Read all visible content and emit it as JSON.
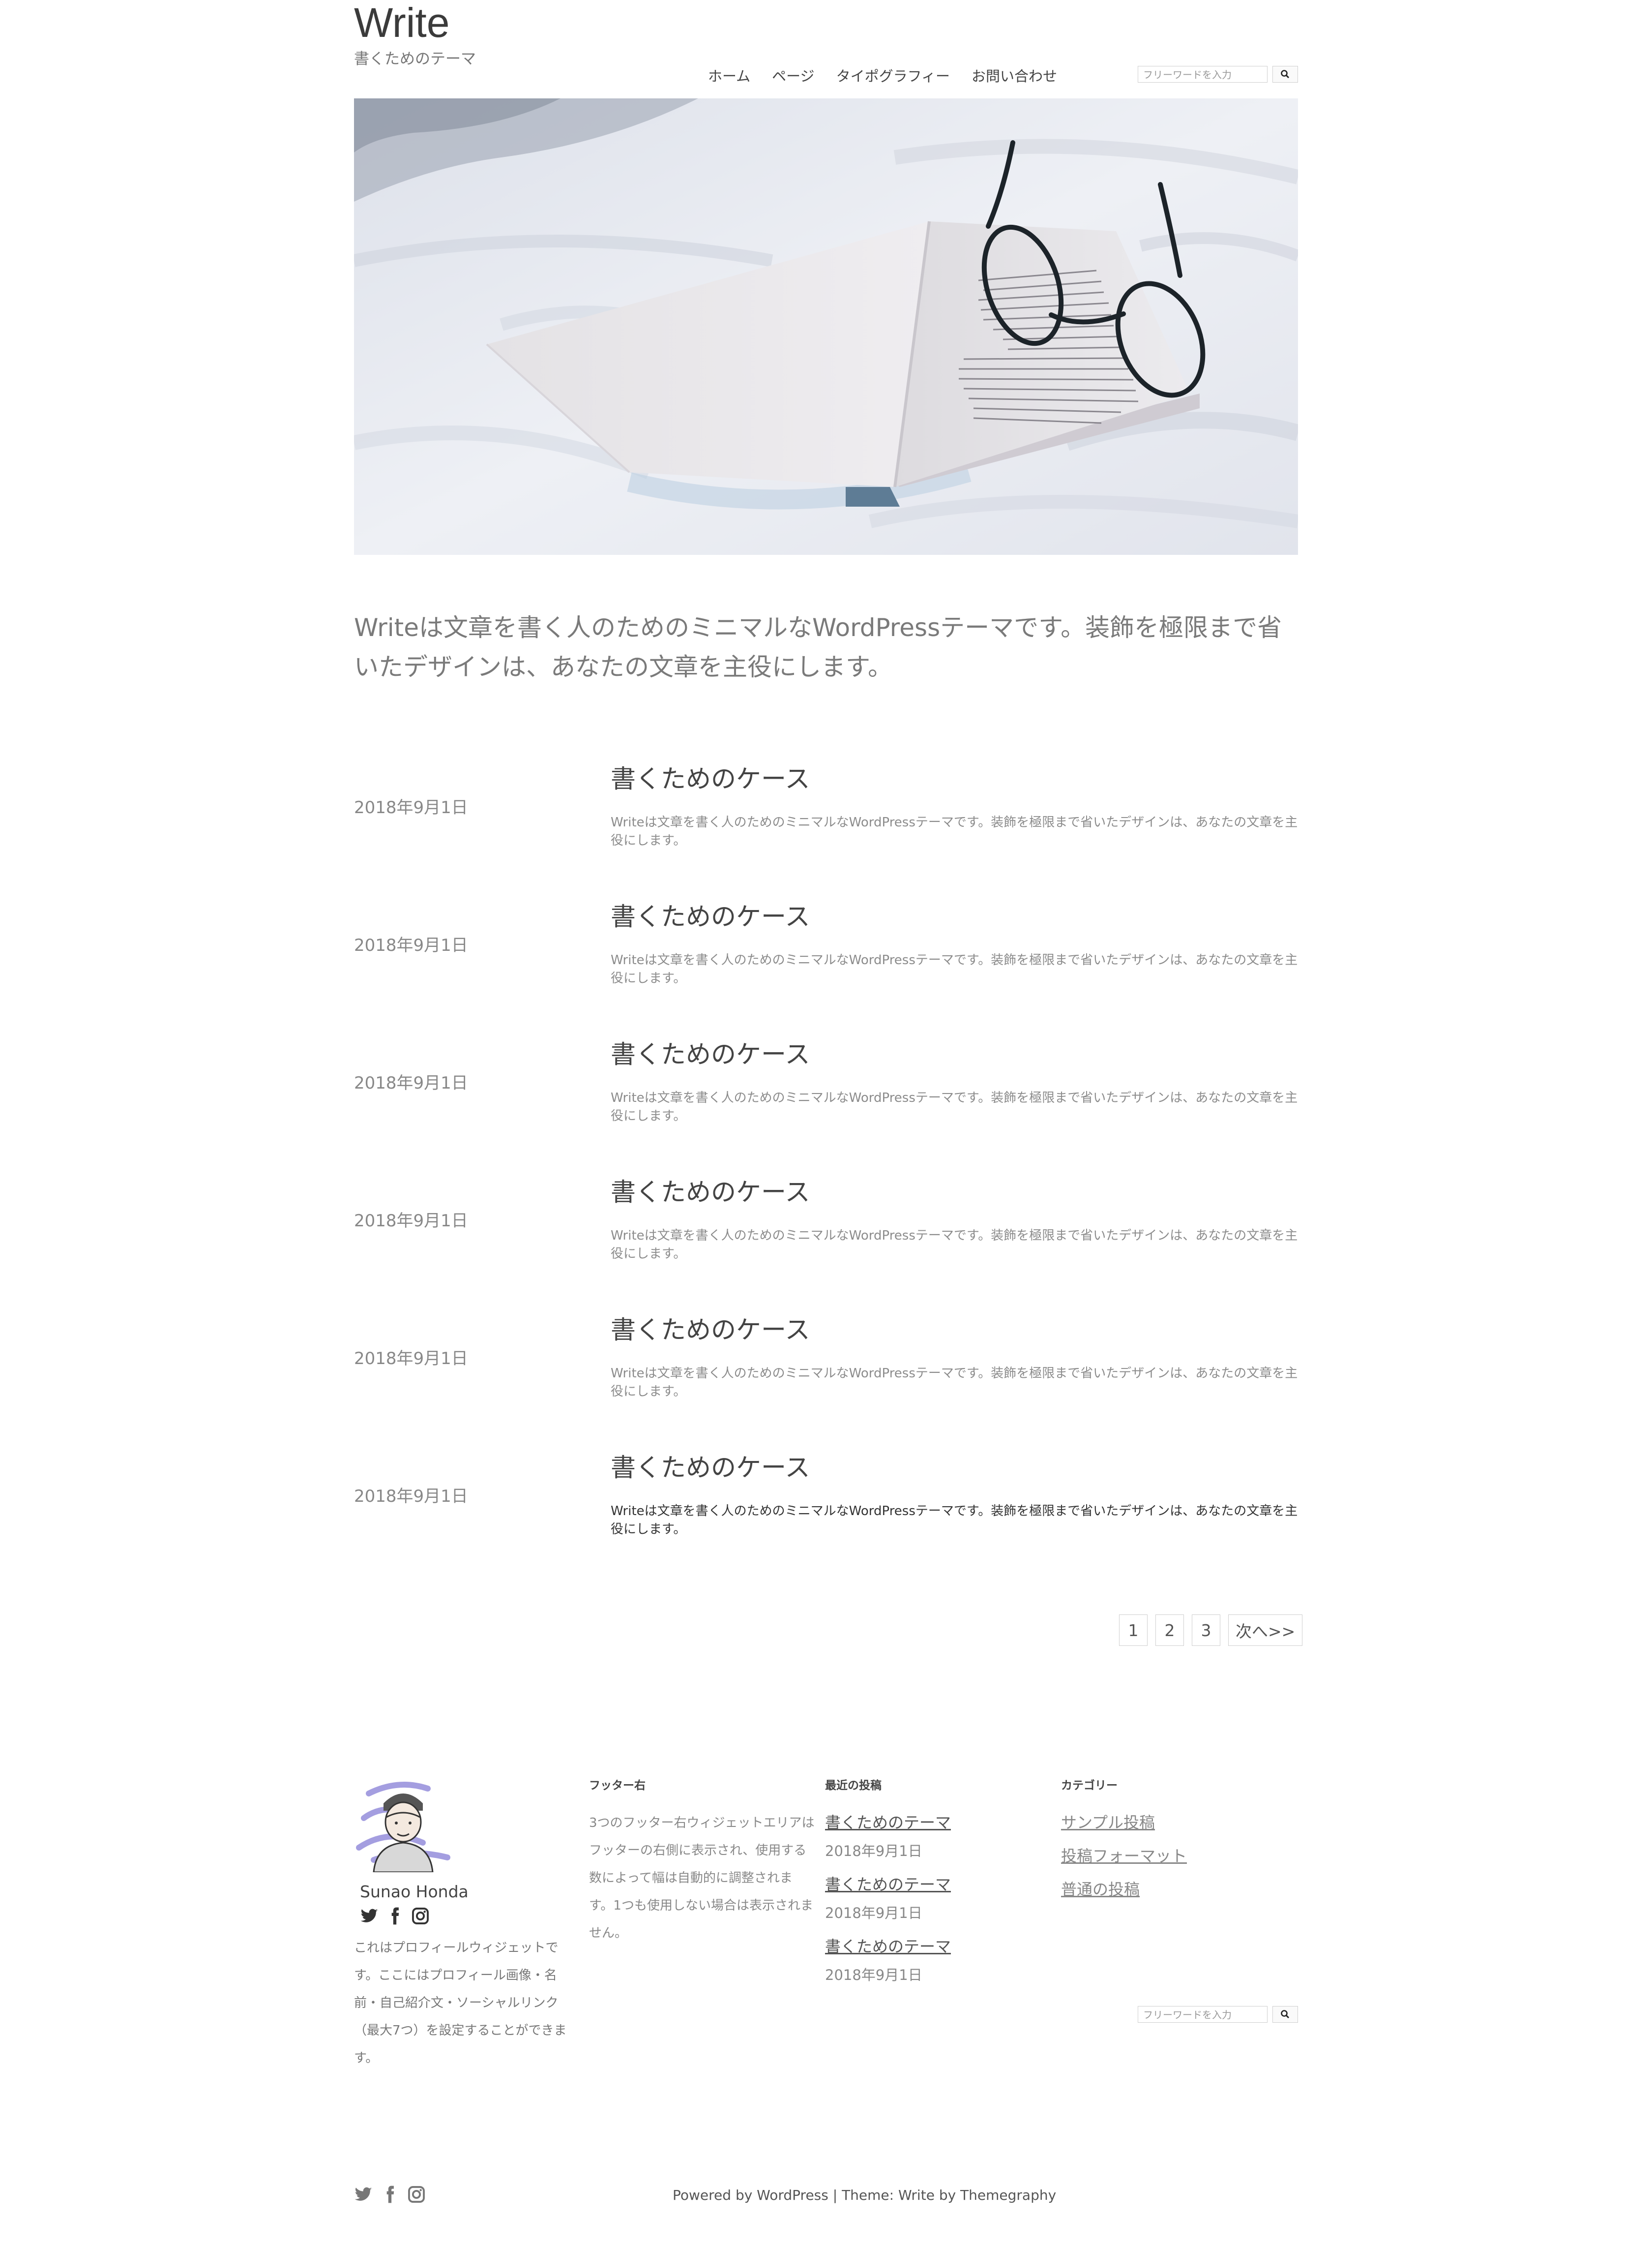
{
  "site": {
    "title": "Write",
    "tagline": "書くためのテーマ"
  },
  "nav": [
    {
      "label": "ホーム"
    },
    {
      "label": "ページ"
    },
    {
      "label": "タイポグラフィー"
    },
    {
      "label": "お問い合わせ"
    }
  ],
  "search": {
    "placeholder": "フリーワードを入力",
    "icon": "search-icon"
  },
  "intro": "Writeは文章を書く人のためのミニマルなWordPressテーマです。装飾を極限まで省いたデザインは、あなたの文章を主役にします。",
  "posts": [
    {
      "date": "2018年9月1日",
      "title": "書くためのケース",
      "excerpt": "Writeは文章を書く人のためのミニマルなWordPressテーマです。装飾を極限まで省いたデザインは、あなたの文章を主役にします。"
    },
    {
      "date": "2018年9月1日",
      "title": "書くためのケース",
      "excerpt": "Writeは文章を書く人のためのミニマルなWordPressテーマです。装飾を極限まで省いたデザインは、あなたの文章を主役にします。"
    },
    {
      "date": "2018年9月1日",
      "title": "書くためのケース",
      "excerpt": "Writeは文章を書く人のためのミニマルなWordPressテーマです。装飾を極限まで省いたデザインは、あなたの文章を主役にします。"
    },
    {
      "date": "2018年9月1日",
      "title": "書くためのケース",
      "excerpt": "Writeは文章を書く人のためのミニマルなWordPressテーマです。装飾を極限まで省いたデザインは、あなたの文章を主役にします。"
    },
    {
      "date": "2018年9月1日",
      "title": "書くためのケース",
      "excerpt": "Writeは文章を書く人のためのミニマルなWordPressテーマです。装飾を極限まで省いたデザインは、あなたの文章を主役にします。"
    },
    {
      "date": "2018年9月1日",
      "title": "書くためのケース",
      "excerpt": "Writeは文章を書く人のためのミニマルなWordPressテーマです。装飾を極限まで省いたデザインは、あなたの文章を主役にします。"
    }
  ],
  "pagination": {
    "pages": [
      "1",
      "2",
      "3"
    ],
    "next": "次へ>>"
  },
  "footer": {
    "profile": {
      "name": "Sunao Honda",
      "text": "これはプロフィールウィジェットです。ここにはプロフィール画像・名前・自己紹介文・ソーシャルリンク（最大7つ）を設定することができます。",
      "social": [
        "twitter-icon",
        "facebook-icon",
        "instagram-icon"
      ]
    },
    "right_widget": {
      "title": "フッター右",
      "text": "3つのフッター右ウィジェットエリアはフッターの右側に表示され、使用する数によって幅は自動的に調整されます。1つも使用しない場合は表示されません。"
    },
    "recent": {
      "title": "最近の投稿",
      "items": [
        {
          "title": "書くためのテーマ",
          "date": "2018年9月1日"
        },
        {
          "title": "書くためのテーマ",
          "date": "2018年9月1日"
        },
        {
          "title": "書くためのテーマ",
          "date": "2018年9月1日"
        }
      ]
    },
    "categories": {
      "title": "カテゴリー",
      "items": [
        "サンプル投稿",
        "投稿フォーマット",
        "普通の投稿"
      ]
    },
    "credits": "Powered by WordPress | Theme: Write by Themegraphy"
  },
  "colors": {
    "text": "#555555",
    "muted": "#888888",
    "border": "#cfcfcf",
    "background": "#ffffff"
  }
}
